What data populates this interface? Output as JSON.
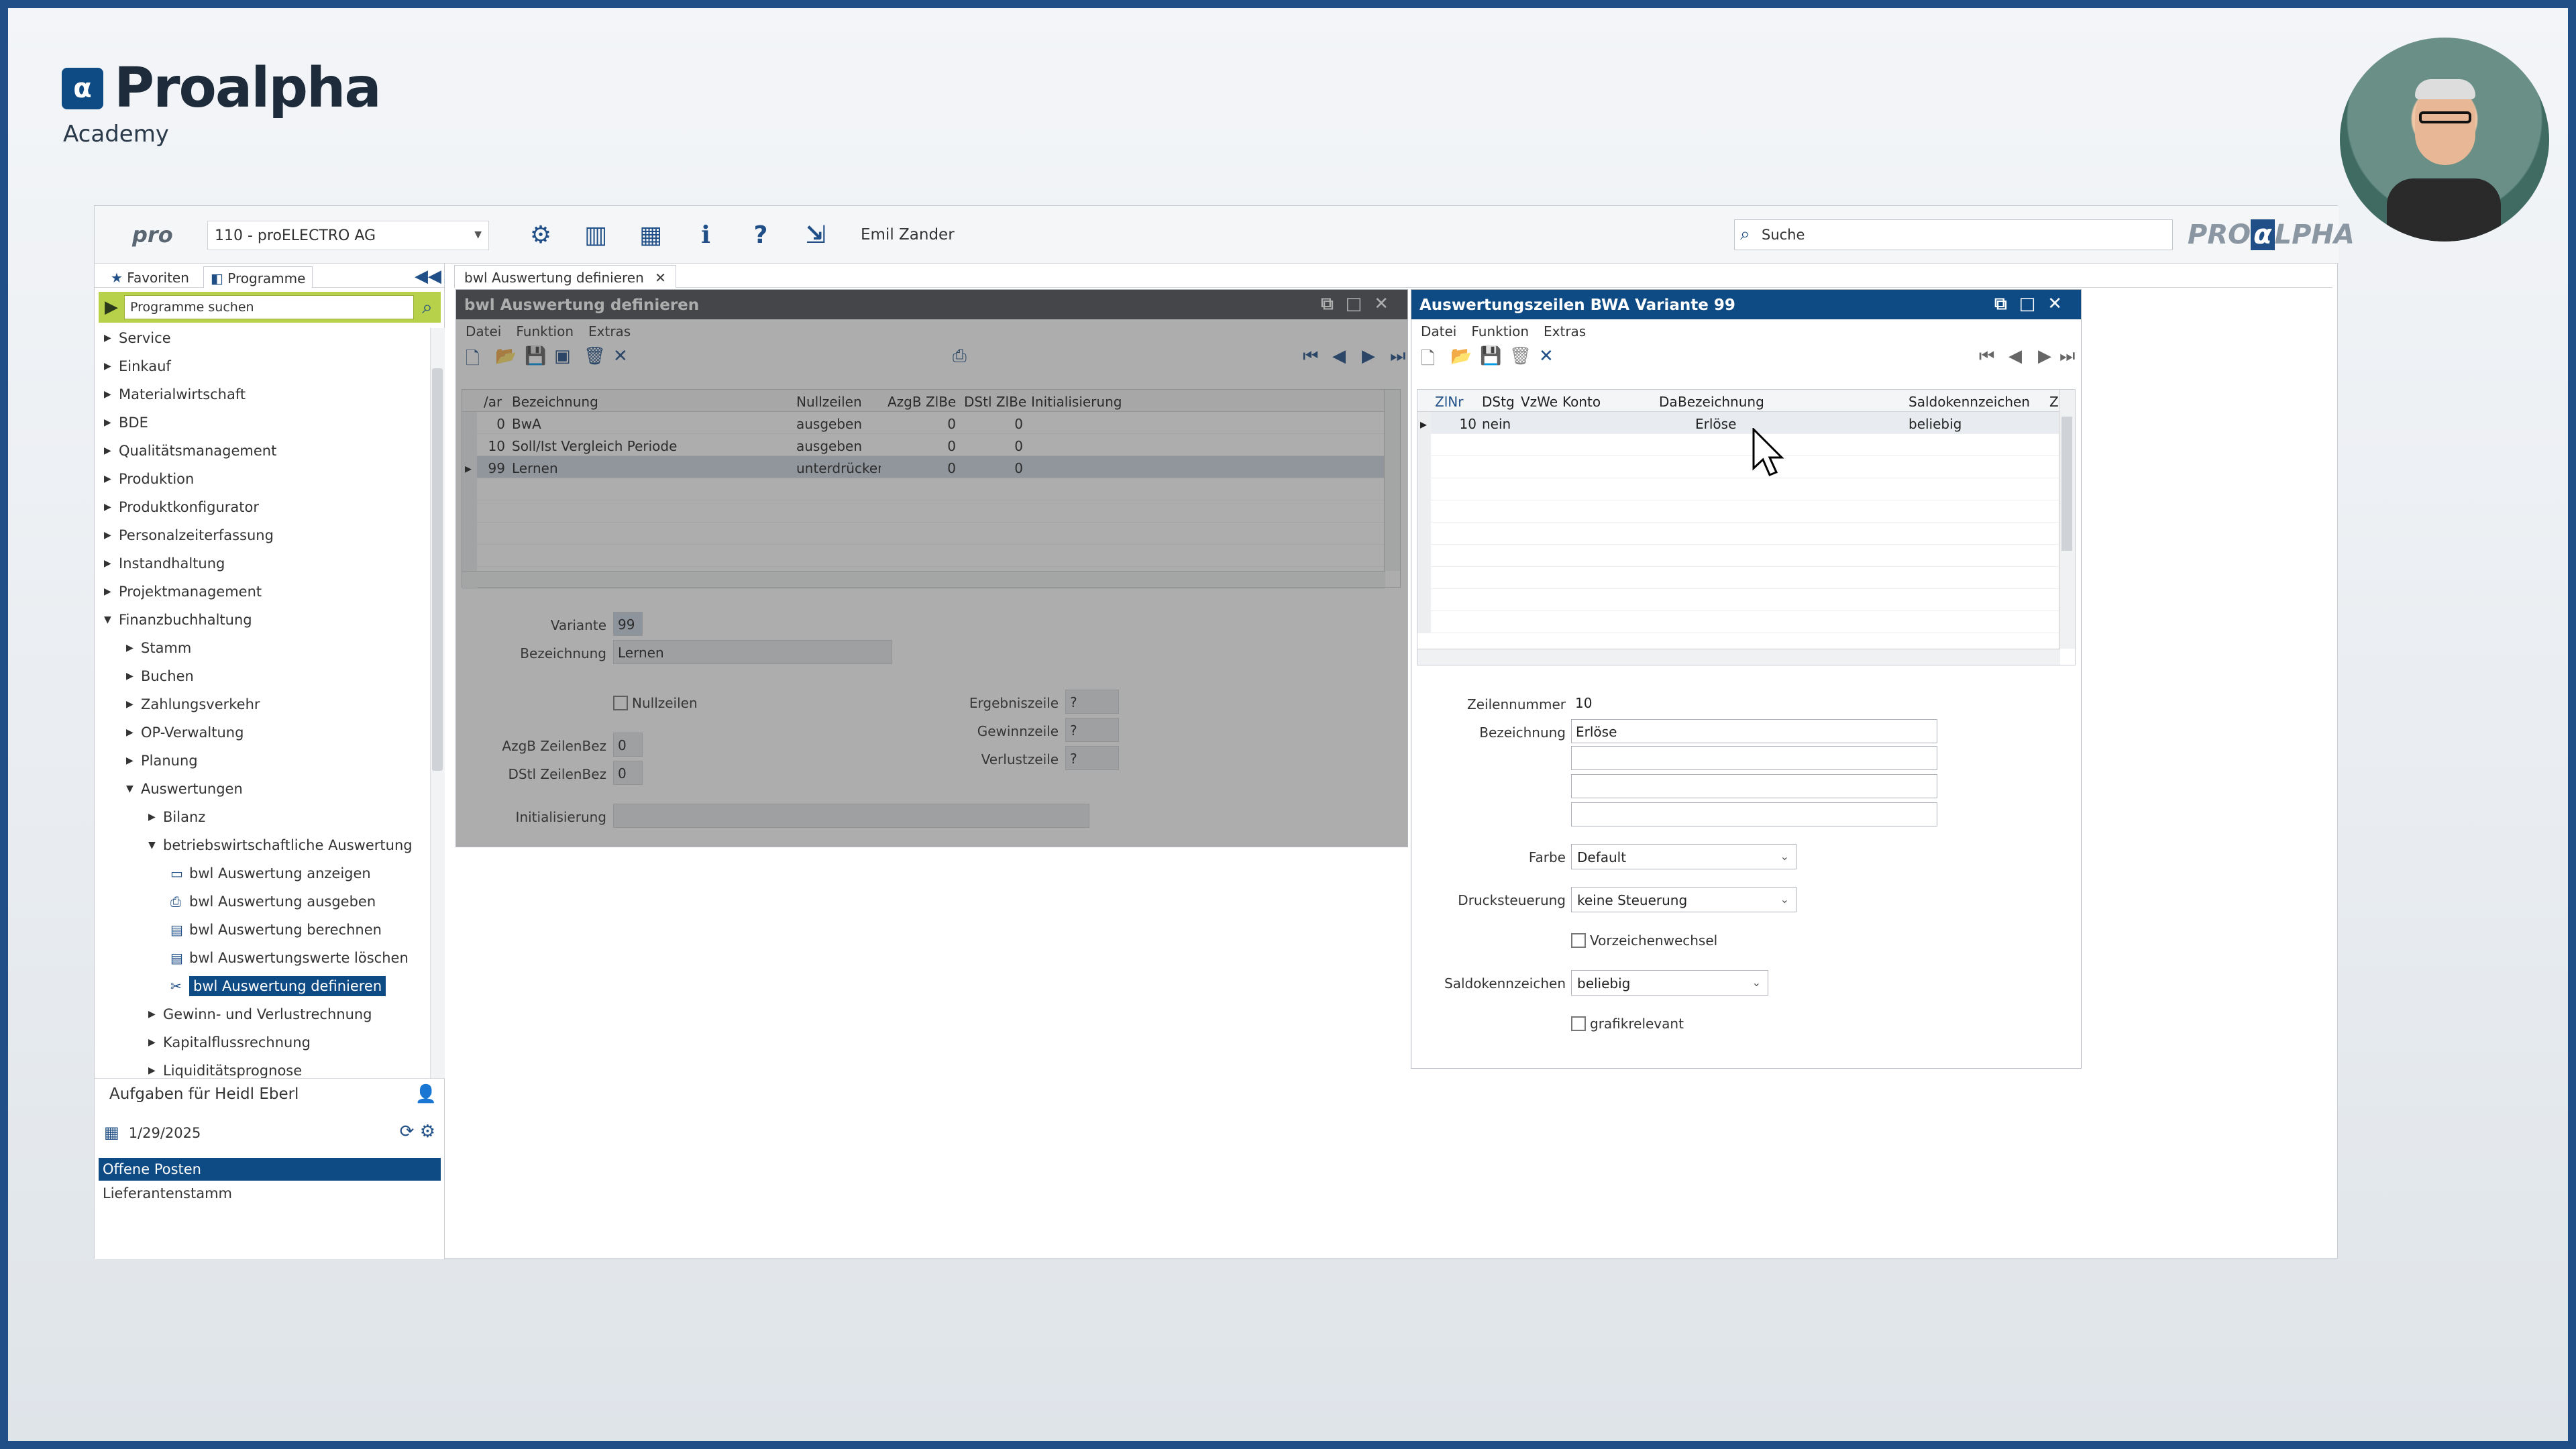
{
  "branding": {
    "name": "Proalpha",
    "sub": "Academy"
  },
  "topbar": {
    "logo": "pro",
    "company": "110 - proELECTRO AG",
    "user": "Emil Zander",
    "search_placeholder": "Suche",
    "brand": "PRO",
    "brand_a": "α",
    "brand_end": "LPHA"
  },
  "sidebar": {
    "tab_favorites": "Favoriten",
    "tab_programs": "Programme",
    "search_placeholder": "Programme suchen",
    "items": [
      "Service",
      "Einkauf",
      "Materialwirtschaft",
      "BDE",
      "Qualitätsmanagement",
      "Produktion",
      "Produktkonfigurator",
      "Personalzeiterfassung",
      "Instandhaltung",
      "Projektmanagement",
      "Finanzbuchhaltung",
      "Stamm",
      "Buchen",
      "Zahlungsverkehr",
      "OP-Verwaltung",
      "Planung",
      "Auswertungen",
      "Bilanz",
      "betriebswirtschaftliche Auswertung",
      "bwl Auswertung anzeigen",
      "bwl Auswertung ausgeben",
      "bwl Auswertung berechnen",
      "bwl Auswertungswerte löschen",
      "bwl Auswertung definieren",
      "Gewinn- und Verlustrechnung",
      "Kapitalflussrechnung",
      "Liquiditätsprognose"
    ],
    "tasks_title": "Aufgaben für Heidl Eberl",
    "tasks_date": "1/29/2025",
    "tasks": [
      "Offene Posten",
      "Lieferantenstamm"
    ]
  },
  "doc_tab": "bwl Auswertung definieren",
  "left_window": {
    "title": "bwl Auswertung definieren",
    "menu": [
      "Datei",
      "Funktion",
      "Extras"
    ],
    "columns": [
      "/ar",
      "Bezeichnung",
      "Nullzeilen",
      "AzgB ZlBe",
      "DStl ZlBe",
      "Initialisierung"
    ],
    "rows": [
      [
        "0",
        "BwA",
        "ausgeben",
        "0",
        "0",
        ""
      ],
      [
        "10",
        "Soll/Ist Vergleich Periode",
        "ausgeben",
        "0",
        "0",
        ""
      ],
      [
        "99",
        "Lernen",
        "unterdrücken",
        "0",
        "0",
        ""
      ]
    ],
    "form": {
      "variante_label": "Variante",
      "variante": "99",
      "bez_label": "Bezeichnung",
      "bez": "Lernen",
      "nullzeilen": "Nullzeilen",
      "azgb_label": "AzgB ZeilenBez",
      "azgb": "0",
      "dstl_label": "DStl ZeilenBez",
      "dstl": "0",
      "init_label": "Initialisierung",
      "ergebnis_label": "Ergebniszeile",
      "ergebnis": "?",
      "gewinn_label": "Gewinnzeile",
      "gewinn": "?",
      "verlust_label": "Verlustzeile",
      "verlust": "?"
    }
  },
  "right_window": {
    "title": "Auswertungszeilen BWA Variante 99",
    "menu": [
      "Datei",
      "Funktion",
      "Extras"
    ],
    "columns": [
      "ZlNr",
      "DStg",
      "VzWe",
      "Konto",
      "Da",
      "Bezeichnung",
      "Saldokennzeichen",
      "Z"
    ],
    "rows": [
      [
        "10",
        "nein",
        "",
        "",
        "",
        "Erlöse",
        "beliebig",
        ""
      ]
    ],
    "form": {
      "zeilennr_label": "Zeilennummer",
      "zeilennr": "10",
      "bez_label": "Bezeichnung",
      "bez": "Erlöse",
      "farbe_label": "Farbe",
      "farbe": "Default",
      "druck_label": "Drucksteuerung",
      "druck": "keine Steuerung",
      "vorzeichen": "Vorzeichenwechsel",
      "saldo_label": "Saldokennzeichen",
      "saldo": "beliebig",
      "grafik": "grafikrelevant"
    }
  },
  "colors": {
    "accent": "#0e4a83",
    "title_dim": "#7a7f85",
    "green": "#b8d14a"
  }
}
